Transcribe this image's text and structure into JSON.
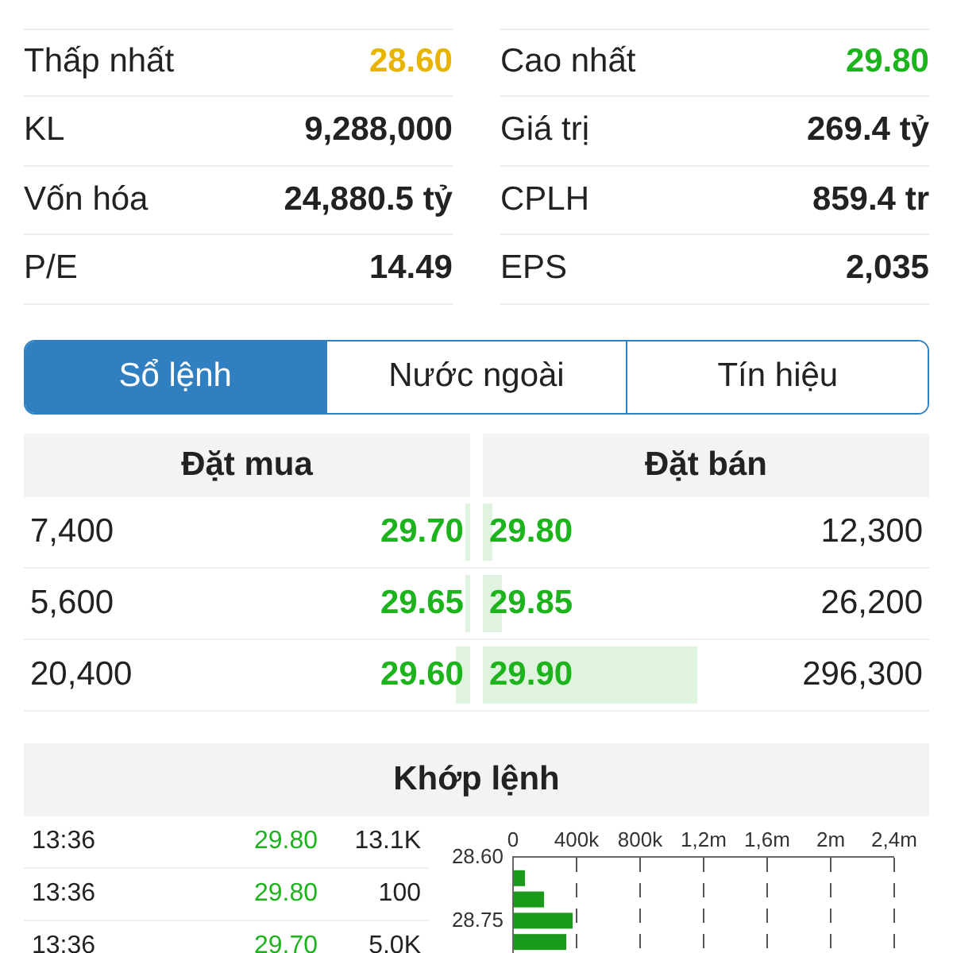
{
  "stats": [
    [
      {
        "label": "Thấp nhất",
        "value": "28.60",
        "color": "#e8b400"
      },
      {
        "label": "Cao nhất",
        "value": "29.80",
        "color": "#1db31d"
      }
    ],
    [
      {
        "label": "KL",
        "value": "9,288,000",
        "color": "#222222"
      },
      {
        "label": "Giá trị",
        "value": "269.4 tỷ",
        "color": "#222222"
      }
    ],
    [
      {
        "label": "Vốn hóa",
        "value": "24,880.5 tỷ",
        "color": "#222222"
      },
      {
        "label": "CPLH",
        "value": "859.4 tr",
        "color": "#222222"
      }
    ],
    [
      {
        "label": "P/E",
        "value": "14.49",
        "color": "#222222"
      },
      {
        "label": "EPS",
        "value": "2,035",
        "color": "#222222"
      }
    ]
  ],
  "tabs": [
    {
      "label": "Sổ lệnh",
      "selected": true
    },
    {
      "label": "Nước ngoài",
      "selected": false
    },
    {
      "label": "Tín hiệu",
      "selected": false
    }
  ],
  "order_book": {
    "bid_title": "Đặt mua",
    "ask_title": "Đặt bán",
    "rows": [
      {
        "bid": {
          "volume": "7,400",
          "price": "29.70"
        },
        "ask": {
          "price": "29.80",
          "volume": "12,300"
        }
      },
      {
        "bid": {
          "volume": "5,600",
          "price": "29.65"
        },
        "ask": {
          "price": "29.85",
          "volume": "26,200"
        }
      },
      {
        "bid": {
          "volume": "20,400",
          "price": "29.60"
        },
        "ask": {
          "price": "29.90",
          "volume": "296,300"
        }
      }
    ]
  },
  "matches": {
    "title": "Khớp lệnh",
    "rows": [
      {
        "time": "13:36",
        "price": "29.80",
        "volume": "13.1K"
      },
      {
        "time": "13:36",
        "price": "29.80",
        "volume": "100"
      },
      {
        "time": "13:36",
        "price": "29.70",
        "volume": "5.0K"
      }
    ],
    "chart_data": {
      "type": "bar",
      "orientation": "horizontal",
      "x": [
        28.65,
        28.7,
        28.75,
        28.8
      ],
      "values": [
        70000,
        190000,
        370000,
        330000
      ],
      "xticks": [
        {
          "value": 0,
          "label": "0"
        },
        {
          "value": 400000,
          "label": "400k"
        },
        {
          "value": 800000,
          "label": "800k"
        },
        {
          "value": 1200000,
          "label": "1,2m"
        },
        {
          "value": 1600000,
          "label": "1,6m"
        },
        {
          "value": 2000000,
          "label": "2m"
        },
        {
          "value": 2400000,
          "label": "2,4m"
        }
      ],
      "yticks": [
        {
          "value": 28.6,
          "label": "28.60"
        },
        {
          "value": 28.75,
          "label": "28.75"
        }
      ],
      "xlim": [
        0,
        2400000
      ],
      "ylim": [
        28.88,
        28.6
      ],
      "grid": true
    }
  }
}
